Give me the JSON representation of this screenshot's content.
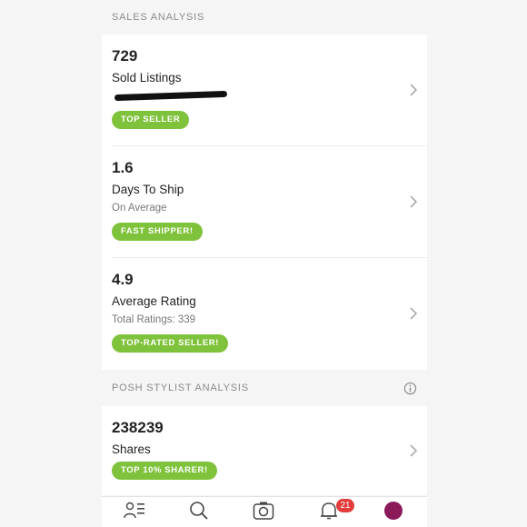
{
  "sales_analysis": {
    "header": "SALES ANALYSIS",
    "rows": [
      {
        "value": "729",
        "title": "Sold Listings",
        "subtitle": "",
        "badge": "TOP SELLER"
      },
      {
        "value": "1.6",
        "title": "Days To Ship",
        "subtitle": "On Average",
        "badge": "FAST SHIPPER!"
      },
      {
        "value": "4.9",
        "title": "Average Rating",
        "subtitle": "Total Ratings: 339",
        "badge": "TOP-RATED SELLER!"
      }
    ]
  },
  "stylist_analysis": {
    "header": "POSH STYLIST ANALYSIS",
    "rows": [
      {
        "value": "238239",
        "title": "Shares",
        "badge": "TOP 10% SHARER!"
      }
    ]
  },
  "tabbar": {
    "notification_count": "21",
    "icons": [
      "feed-icon",
      "search-icon",
      "camera-icon",
      "bell-icon",
      "profile-icon"
    ]
  },
  "colors": {
    "badge": "#7fc23c",
    "notification": "#e23b3b",
    "avatar": "#8a1a5a"
  }
}
